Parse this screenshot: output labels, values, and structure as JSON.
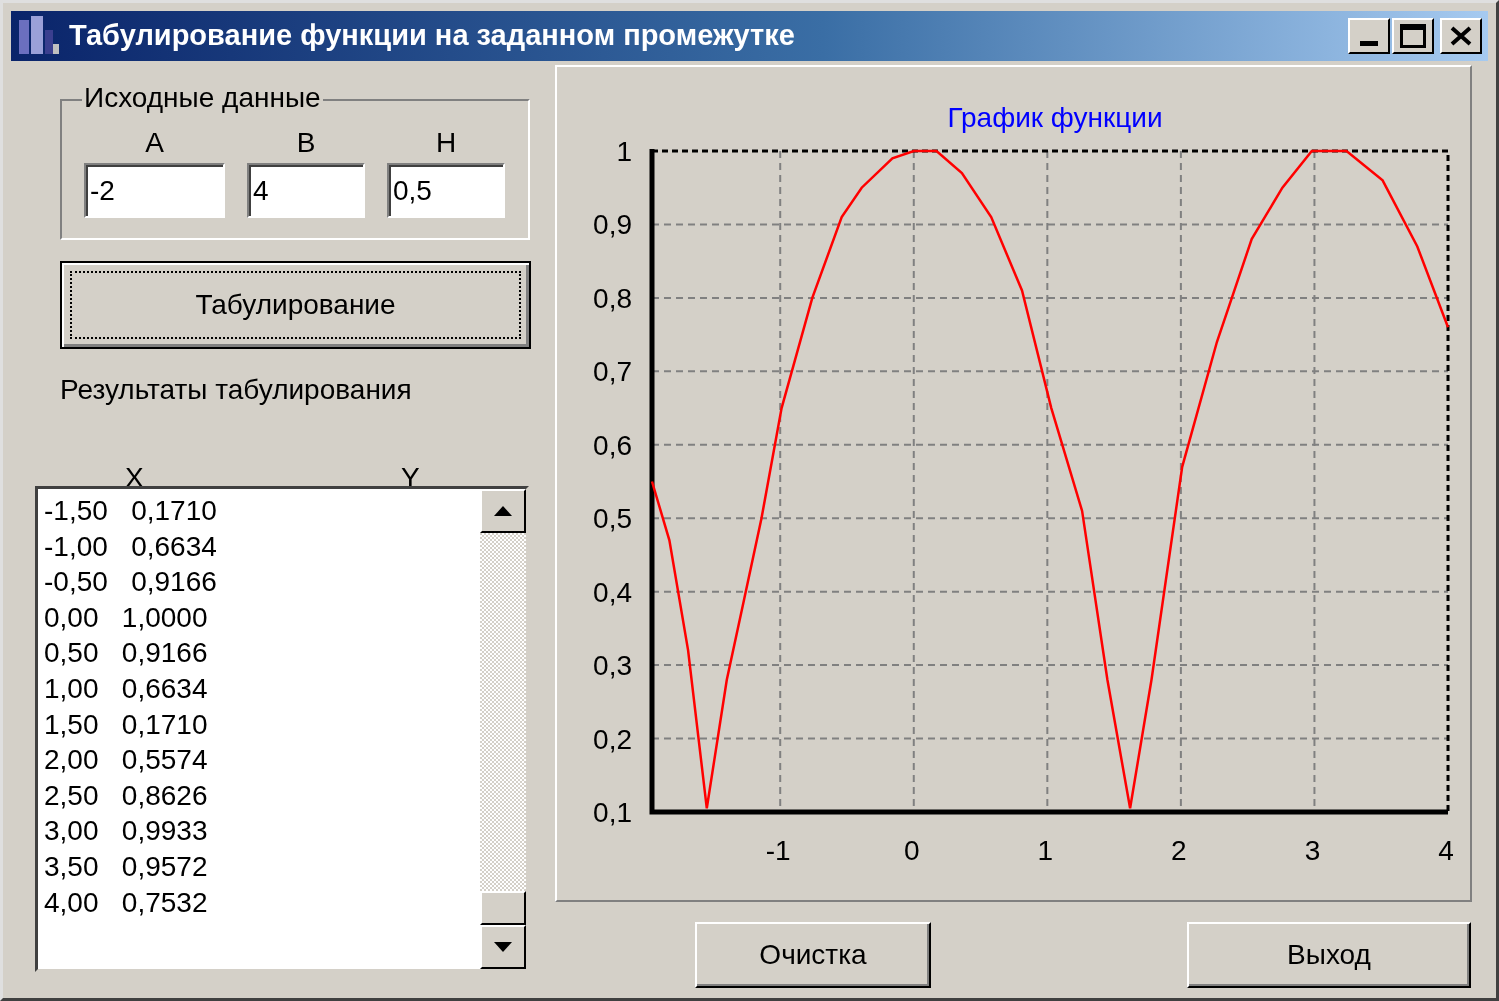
{
  "window": {
    "title": "Табулирование функции на заданном промежутке"
  },
  "input_group": {
    "title": "Исходные данные",
    "fields": [
      {
        "label": "A",
        "value": "-2"
      },
      {
        "label": "B",
        "value": "4"
      },
      {
        "label": "H",
        "value": "0,5"
      }
    ]
  },
  "tabulate_button": {
    "label": "Табулирование",
    "focused": true
  },
  "results_label": "Результаты табулирования",
  "results_columns": [
    "X",
    "Y"
  ],
  "results": [
    "-1,50   0,1710",
    "-1,00   0,6634",
    "-0,50   0,9166",
    "0,00   1,0000",
    "0,50   0,9166",
    "1,00   0,6634",
    "1,50   0,1710",
    "2,00   0,5574",
    "2,50   0,8626",
    "3,00   0,9933",
    "3,50   0,9572",
    "4,00   0,7532"
  ],
  "chart": {
    "chart_data": {
      "type": "line",
      "title": "График функции",
      "x": [
        -1.96,
        -1.83,
        -1.69,
        -1.55,
        -1.4,
        -1.27,
        -1.14,
        -0.99,
        -0.76,
        -0.54,
        -0.39,
        -0.16,
        0,
        0.17,
        0.36,
        0.58,
        0.81,
        1.03,
        1.26,
        1.45,
        1.62,
        1.78,
        2.01,
        2.27,
        2.53,
        2.76,
        2.98,
        3.24,
        3.51,
        3.77,
        4
      ],
      "grid": true,
      "series": [
        {
          "color": "#ff0000",
          "values": [
            0.55,
            0.47,
            0.32,
            0.105,
            0.28,
            0.39,
            0.5,
            0.65,
            0.8,
            0.91,
            0.95,
            0.99,
            1,
            1,
            0.97,
            0.91,
            0.81,
            0.65,
            0.51,
            0.28,
            0.105,
            0.28,
            0.57,
            0.74,
            0.88,
            0.95,
            1,
            1,
            0.96,
            0.87,
            0.76
          ]
        }
      ],
      "xlim": [
        -1.96,
        4
      ],
      "ylim": [
        0.1,
        1
      ],
      "xticks": [
        {
          "value": -1,
          "label": "-1"
        },
        {
          "value": 0,
          "label": "0"
        },
        {
          "value": 1,
          "label": "1"
        },
        {
          "value": 2,
          "label": "2"
        },
        {
          "value": 3,
          "label": "3"
        },
        {
          "value": 4,
          "label": "4"
        }
      ],
      "yticks": [
        {
          "value": 0.1,
          "label": "0,1"
        },
        {
          "value": 0.2,
          "label": "0,2"
        },
        {
          "value": 0.3,
          "label": "0,3"
        },
        {
          "value": 0.4,
          "label": "0,4"
        },
        {
          "value": 0.5,
          "label": "0,5"
        },
        {
          "value": 0.6,
          "label": "0,6"
        },
        {
          "value": 0.7,
          "label": "0,7"
        },
        {
          "value": 0.8,
          "label": "0,8"
        },
        {
          "value": 0.9,
          "label": "0,9"
        },
        {
          "value": 1,
          "label": "1"
        }
      ]
    }
  },
  "buttons": [
    "Очистка",
    "Выход"
  ]
}
